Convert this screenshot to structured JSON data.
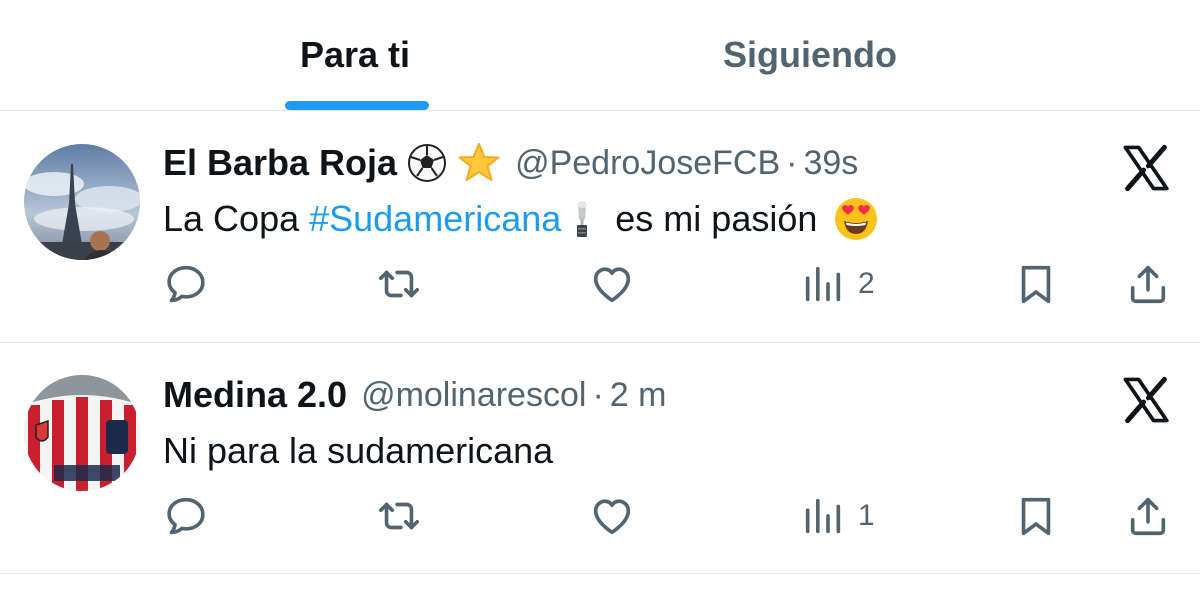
{
  "tabs": [
    {
      "label": "Para ti",
      "selected": true
    },
    {
      "label": "Siguiendo",
      "selected": false
    }
  ],
  "colors": {
    "accent": "#1d9bf0",
    "secondary_text": "#536471",
    "primary_text": "#0f1419",
    "divider": "#e6e9eb"
  },
  "tweets": [
    {
      "display_name": "El Barba Roja",
      "name_emojis": [
        "soccer-ball-icon",
        "star-icon"
      ],
      "handle": "@PedroJoseFCB",
      "separator": "·",
      "time": "39s",
      "text_before": "La Copa ",
      "hashtag": "#Sudamericana",
      "text_after": " es mi pasión",
      "inline_icons": [
        "trophy-icon",
        "heart-eyes-emoji"
      ],
      "views": "2",
      "source_icon": "x-logo-icon"
    },
    {
      "display_name": "Medina 2.0",
      "handle": "@molinarescol",
      "separator": "·",
      "time": "2 m",
      "text": "Ni para la sudamericana",
      "views": "1",
      "source_icon": "x-logo-icon"
    }
  ],
  "action_icons": [
    "reply-icon",
    "retweet-icon",
    "like-icon",
    "views-icon",
    "bookmark-icon",
    "share-icon"
  ]
}
